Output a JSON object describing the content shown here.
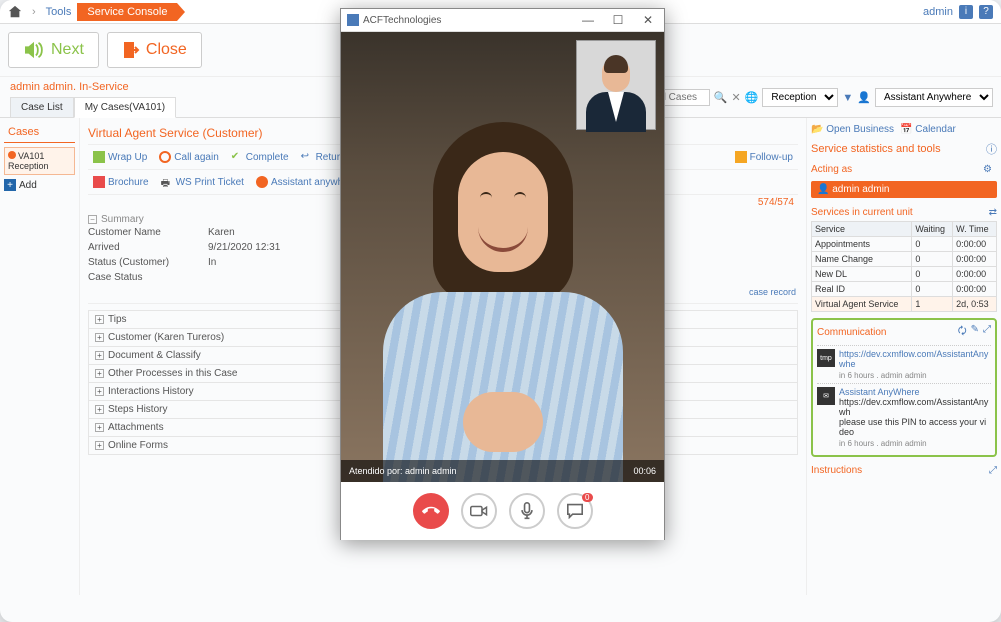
{
  "breadcrumb": {
    "tools": "Tools",
    "active": "Service Console"
  },
  "top_right": {
    "user": "admin"
  },
  "actions": {
    "next": "Next",
    "close": "Close"
  },
  "filters": {
    "search_placeholder": "nd Cases",
    "location": "Reception",
    "assistant": "Assistant Anywhere"
  },
  "status": "admin admin. In-Service",
  "tabs": {
    "list": "Case List",
    "mycases": "My Cases(VA101)"
  },
  "cases": {
    "header": "Cases",
    "current": {
      "id": "VA101",
      "location": "Reception"
    },
    "add": "Add"
  },
  "service": {
    "title": "Virtual Agent Service (Customer)",
    "tools": {
      "wrapup": "Wrap Up",
      "callagain": "Call again",
      "complete": "Complete",
      "return": "Return to Queue",
      "brochure": "Brochure",
      "print": "WS Print Ticket",
      "assist": "Assistant anywhere",
      "followup": "Follow-up"
    },
    "count": "574/574",
    "summary": "Summary",
    "fields": {
      "name_label": "Customer Name",
      "name_value": "Karen",
      "arrived_label": "Arrived",
      "arrived_value": "9/21/2020 12:31",
      "status_label": "Status (Customer)",
      "status_value": "In",
      "case_label": "Case Status"
    },
    "record_link": "case record",
    "sections": [
      "Tips",
      "Customer (Karen Tureros)",
      "Document & Classify",
      "Other Processes in this Case",
      "Interactions History",
      "Steps History",
      "Attachments",
      "Online Forms"
    ]
  },
  "right_links": {
    "open": "Open Business",
    "calendar": "Calendar"
  },
  "stats": {
    "header": "Service statistics and tools",
    "acting_label": "Acting as",
    "acting_value": "admin admin",
    "services_label": "Services in current unit",
    "columns": {
      "service": "Service",
      "waiting": "Waiting",
      "wtime": "W. Time"
    },
    "rows": [
      {
        "name": "Appointments",
        "waiting": "0",
        "wtime": "0:00:00"
      },
      {
        "name": "Name Change",
        "waiting": "0",
        "wtime": "0:00:00"
      },
      {
        "name": "New DL",
        "waiting": "0",
        "wtime": "0:00:00"
      },
      {
        "name": "Real ID",
        "waiting": "0",
        "wtime": "0:00:00"
      },
      {
        "name": "Virtual Agent Service",
        "waiting": "1",
        "wtime": "2d, 0:53"
      }
    ]
  },
  "communication": {
    "header": "Communication",
    "msg1": {
      "tag": "tmp",
      "url": "https://dev.cxmflow.com/AssistantAnywhe",
      "meta": "in 6 hours . admin admin"
    },
    "msg2": {
      "title": "Assistant AnyWhere",
      "url": "https://dev.cxmflow.com/AssistantAnywh",
      "body": "please use this PIN to access your video",
      "meta": "in 6 hours . admin admin"
    }
  },
  "instructions": "Instructions",
  "video": {
    "title": "ACFTechnologies",
    "attended": "Atendido por: admin admin",
    "timer": "00:06",
    "chat_badge": "0"
  }
}
